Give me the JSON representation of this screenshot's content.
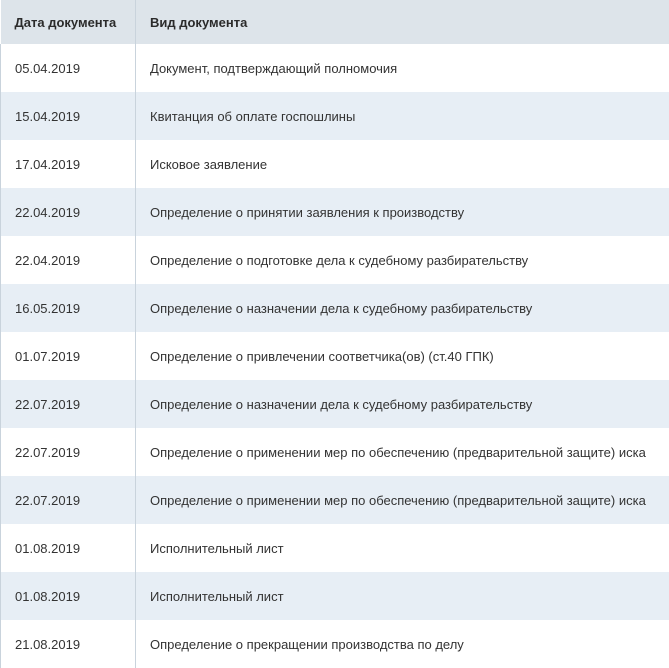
{
  "table": {
    "headers": [
      "Дата документа",
      "Вид документа"
    ],
    "rows": [
      {
        "date": "05.04.2019",
        "type": "Документ, подтверждающий полномочия"
      },
      {
        "date": "15.04.2019",
        "type": "Квитанция об оплате госпошлины"
      },
      {
        "date": "17.04.2019",
        "type": "Исковое заявление"
      },
      {
        "date": "22.04.2019",
        "type": "Определение о принятии заявления к производству"
      },
      {
        "date": "22.04.2019",
        "type": "Определение о подготовке дела к судебному разбирательству"
      },
      {
        "date": "16.05.2019",
        "type": "Определение о назначении дела к судебному разбирательству"
      },
      {
        "date": "01.07.2019",
        "type": "Определение о привлечении соответчика(ов) (ст.40 ГПК)"
      },
      {
        "date": "22.07.2019",
        "type": "Определение о назначении дела к судебному разбирательству"
      },
      {
        "date": "22.07.2019",
        "type": "Определение о применении мер по обеспечению (предварительной защите) иска"
      },
      {
        "date": "22.07.2019",
        "type": "Определение о применении мер по обеспечению (предварительной защите) иска"
      },
      {
        "date": "01.08.2019",
        "type": "Исполнительный лист"
      },
      {
        "date": "01.08.2019",
        "type": "Исполнительный лист"
      },
      {
        "date": "21.08.2019",
        "type": "Определение о прекращении производства по делу"
      }
    ]
  },
  "colors": {
    "header_bg": "#dde4ea",
    "row_alt_bg": "#e7eef5",
    "row_bg": "#ffffff",
    "text": "#333333"
  }
}
